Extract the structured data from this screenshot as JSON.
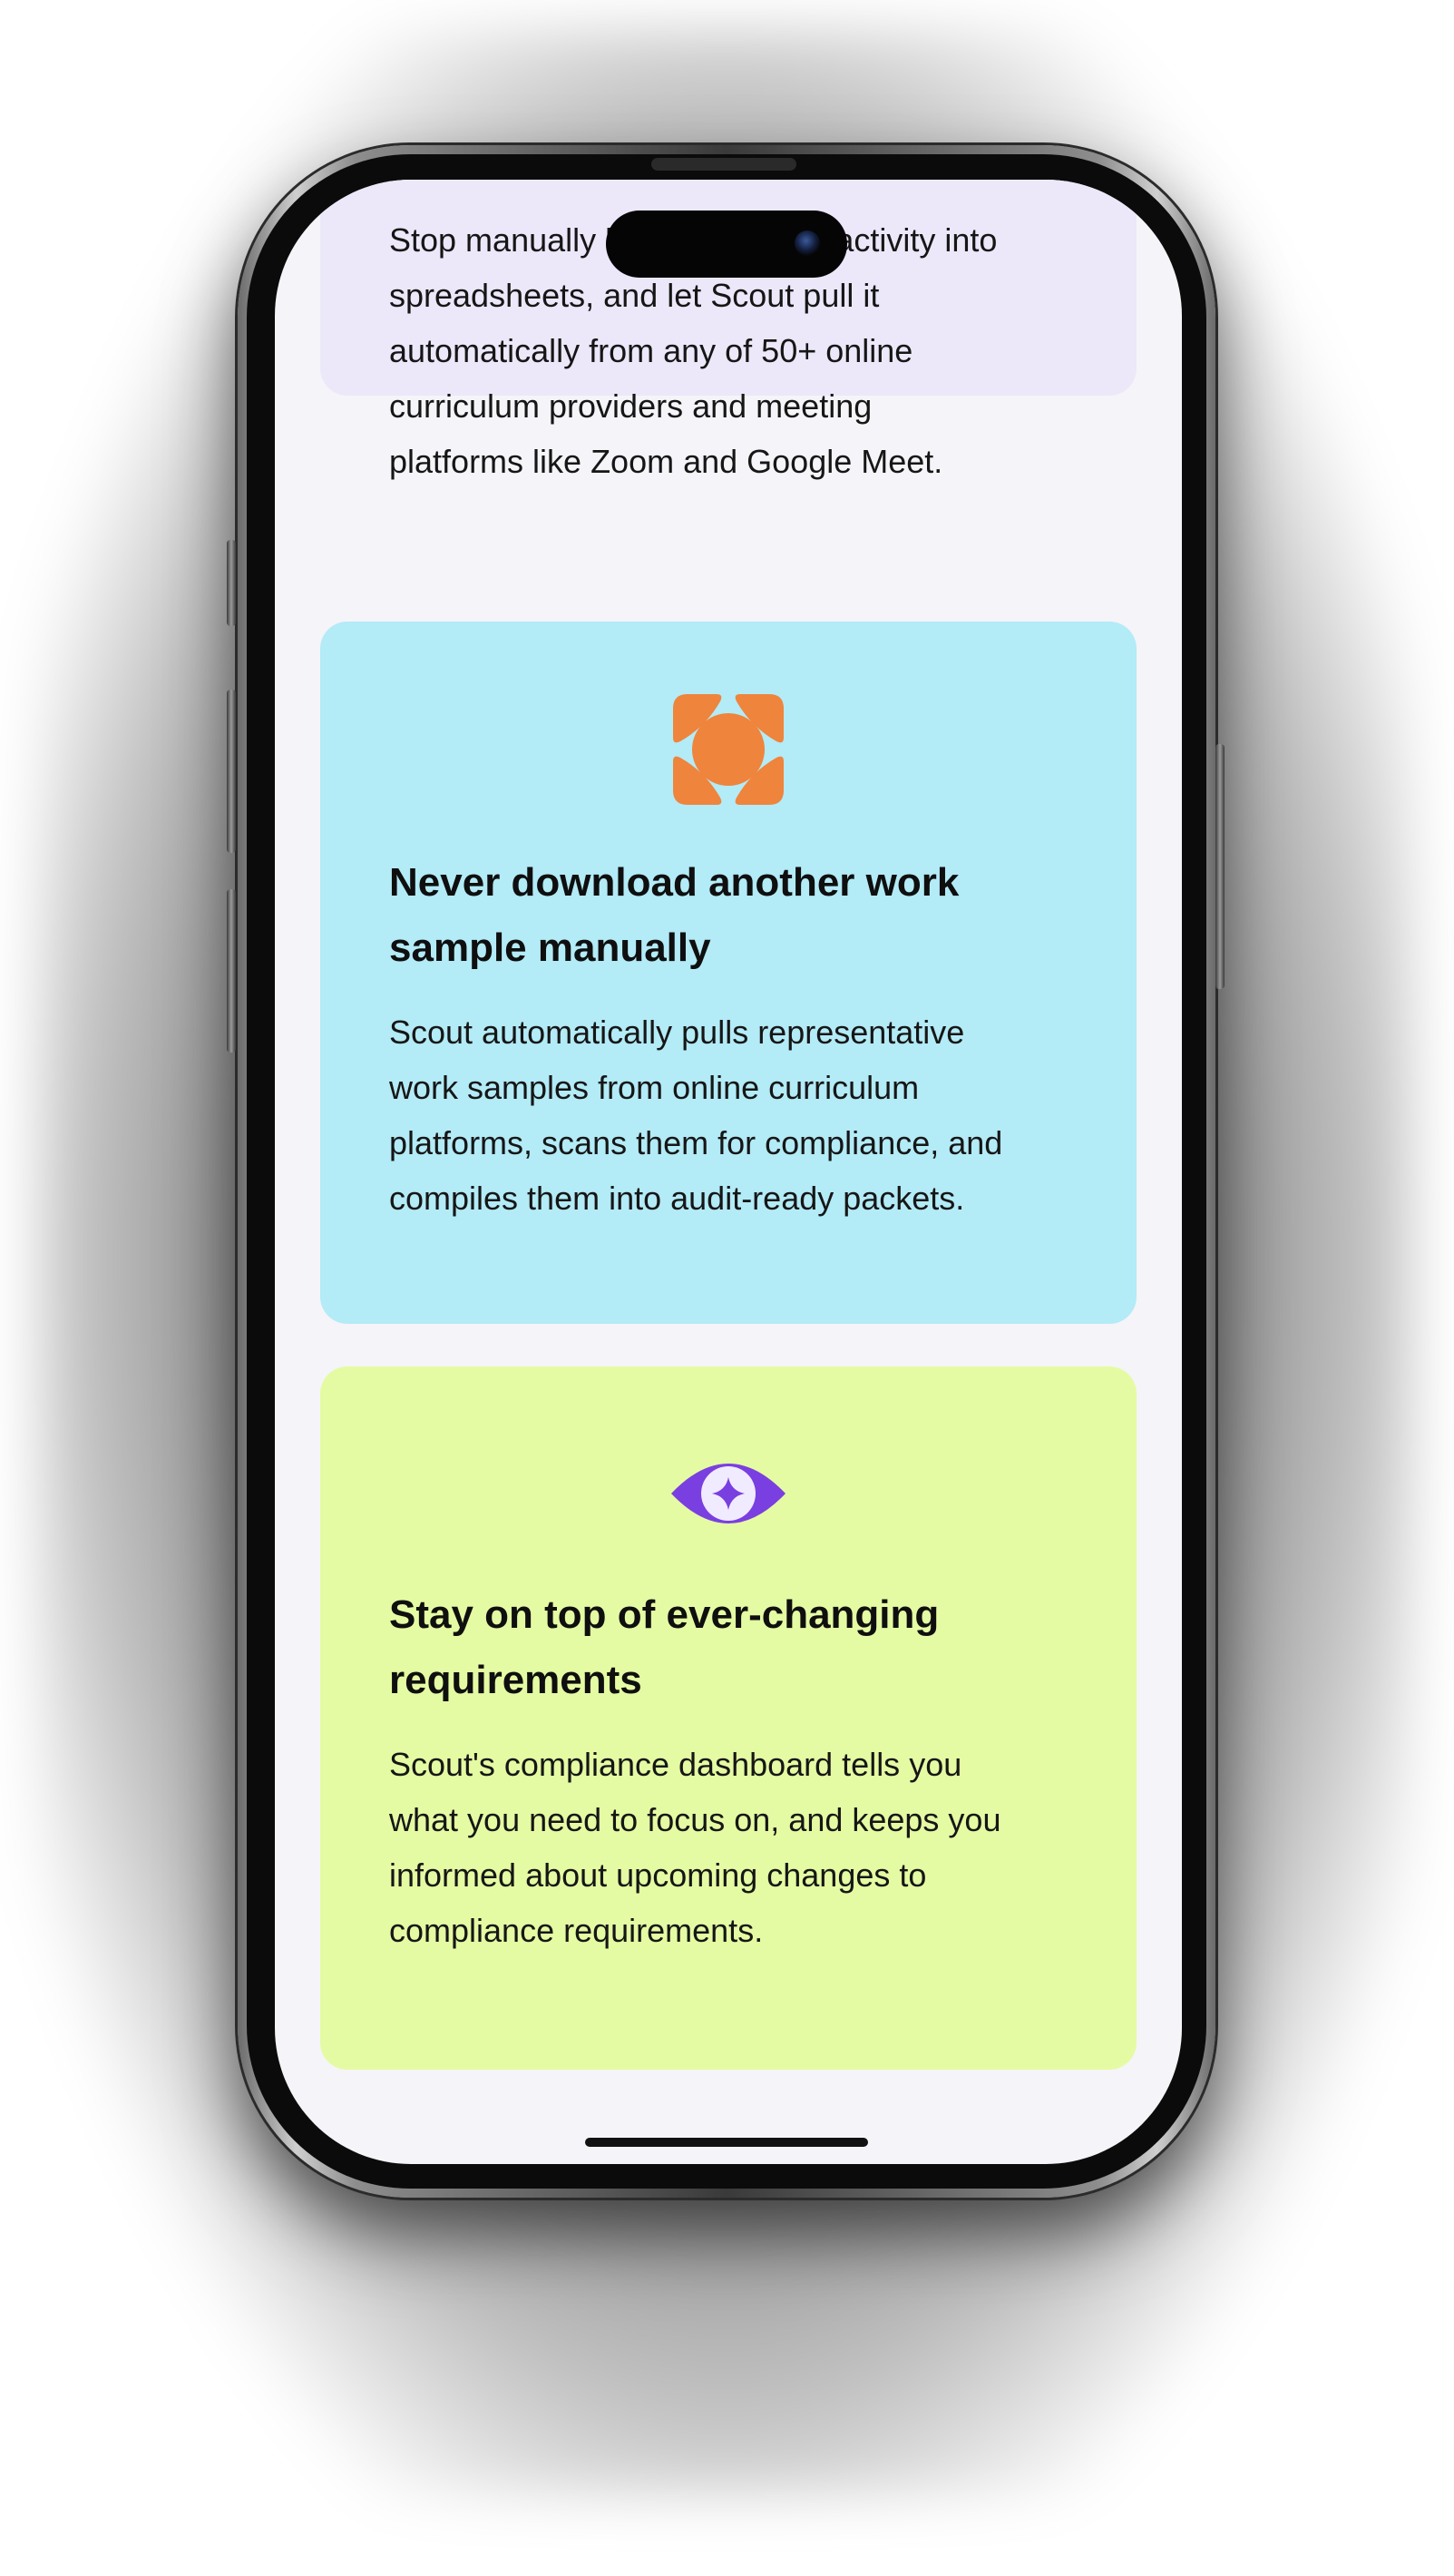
{
  "cards": [
    {
      "title": "",
      "text_lines": [
        "Stop manually logging student activity into",
        "spreadsheets, and let Scout pull it",
        "automatically from any of 50+ online",
        "curriculum providers and meeting",
        "platforms like Zoom and Google Meet."
      ],
      "color": "#ece8f9"
    },
    {
      "icon": "orange-frame-icon",
      "title_lines": [
        "Never download another work",
        "sample manually"
      ],
      "text_lines": [
        "Scout automatically pulls representative",
        "work samples from online curriculum",
        "platforms, scans them for compliance, and",
        "compiles them into audit-ready packets."
      ],
      "color": "#b3ebf7",
      "icon_color": "#ef843c"
    },
    {
      "icon": "eye-sparkle-icon",
      "title_lines": [
        "Stay on top of ever-changing",
        "requirements"
      ],
      "text_lines": [
        "Scout's compliance dashboard tells you",
        "what you need to focus on, and keeps you",
        "informed about upcoming changes to",
        "compliance requirements."
      ],
      "color": "#e5fba3",
      "icon_color": "#7a3fe0"
    }
  ]
}
